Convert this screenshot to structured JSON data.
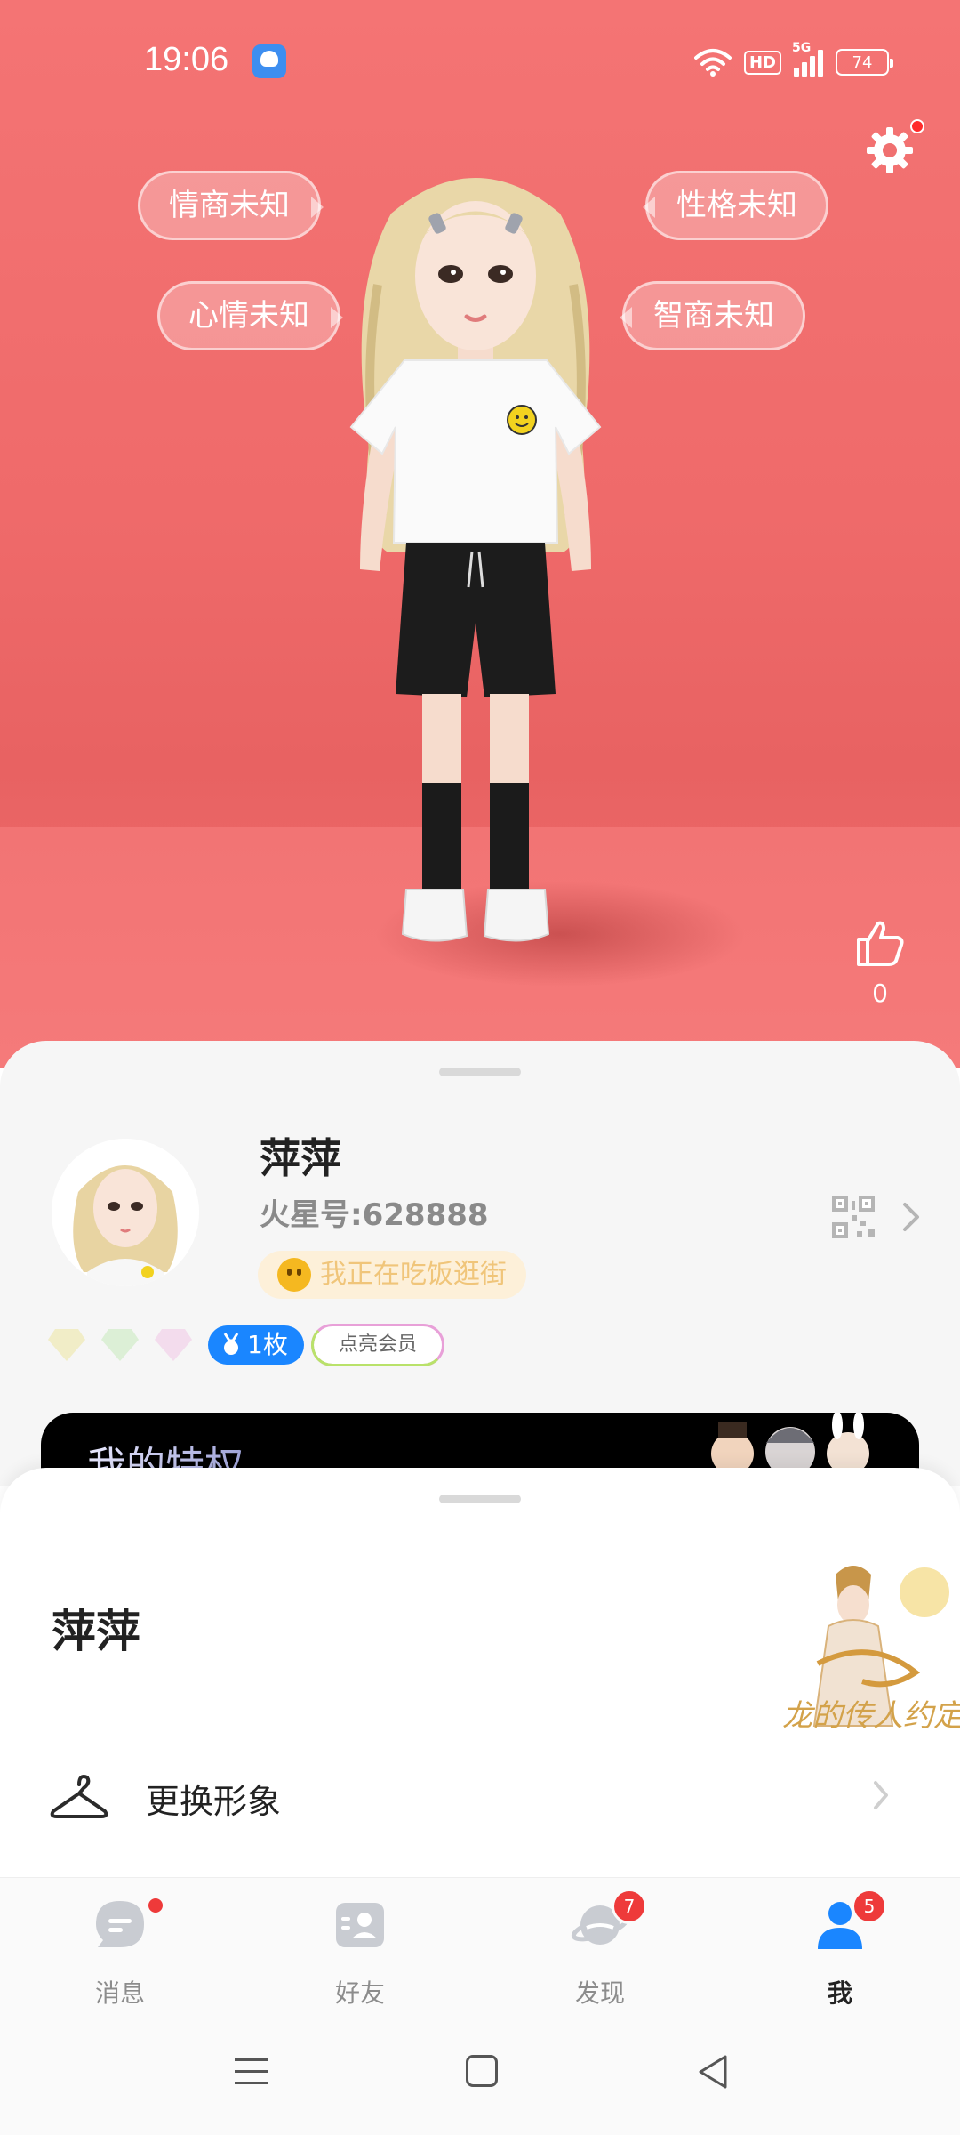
{
  "status_bar": {
    "time": "19:06",
    "network": "5G",
    "hd": "HD",
    "battery": "74"
  },
  "traits": {
    "eq": "情商未知",
    "mood": "心情未知",
    "personality": "性格未知",
    "iq": "智商未知"
  },
  "likes": {
    "count": "0"
  },
  "profile": {
    "name": "萍萍",
    "id_text": "火星号:628888",
    "status": "我正在吃饭逛街",
    "medal_count": "1枚",
    "vip_label": "点亮会员",
    "privilege_title": "我的特权"
  },
  "sheet": {
    "name": "萍萍",
    "promo_text": "龙的传人约定",
    "change_look_label": "更换形象"
  },
  "tabs": [
    {
      "label": "消息",
      "icon": "message-icon",
      "dot": true
    },
    {
      "label": "好友",
      "icon": "friends-icon"
    },
    {
      "label": "发现",
      "icon": "planet-icon",
      "badge": "7"
    },
    {
      "label": "我",
      "icon": "user-icon",
      "badge": "5",
      "active": true
    }
  ],
  "colors": {
    "hero": "#f07070",
    "accent_blue": "#1a86ff",
    "badge_red": "#ee3a3a"
  }
}
